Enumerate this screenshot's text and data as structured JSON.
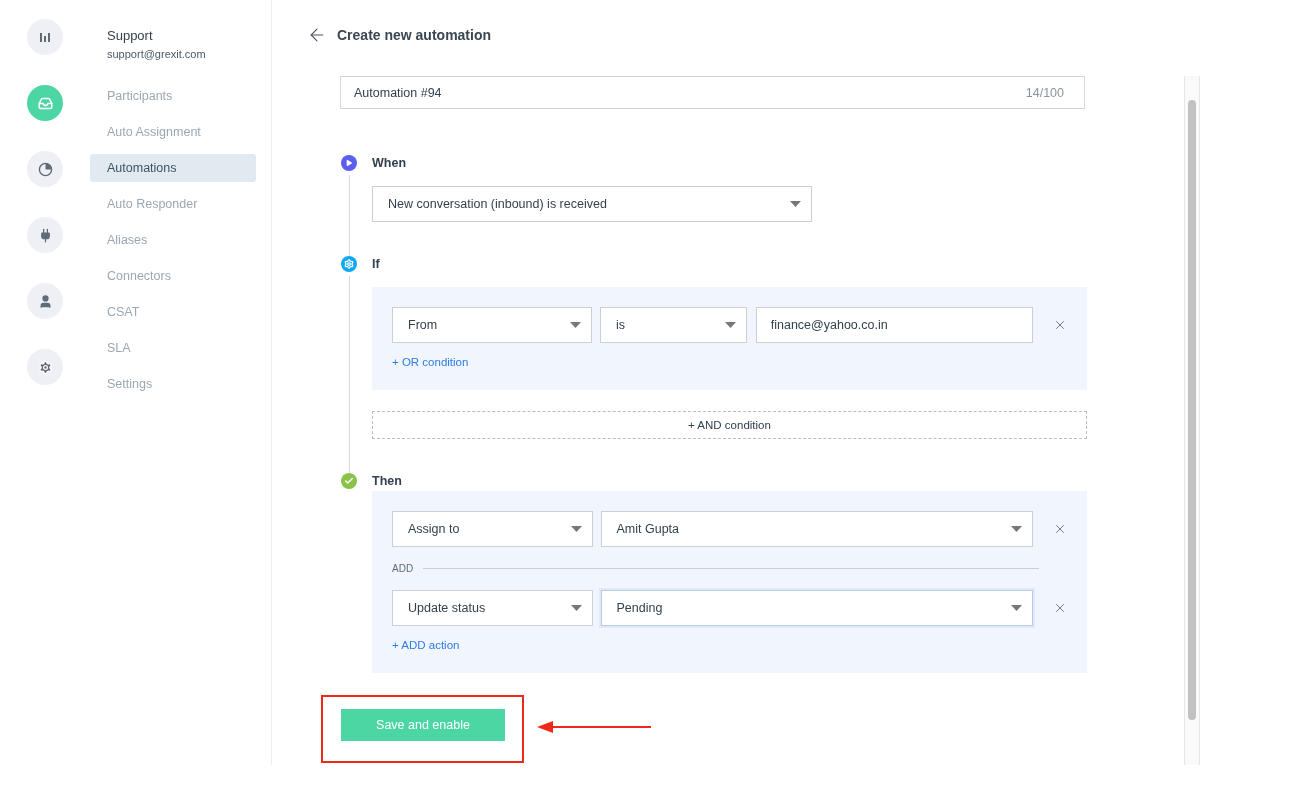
{
  "rail": [
    {
      "kind": "bars",
      "selected": false
    },
    {
      "kind": "inbox",
      "selected": true
    },
    {
      "kind": "pie",
      "selected": false
    },
    {
      "kind": "plug",
      "selected": false
    },
    {
      "kind": "user",
      "selected": false
    },
    {
      "kind": "gear",
      "selected": false
    }
  ],
  "account": {
    "name": "Support",
    "email": "support@grexit.com"
  },
  "nav": [
    {
      "label": "Participants",
      "selected": false
    },
    {
      "label": "Auto Assignment",
      "selected": false
    },
    {
      "label": "Automations",
      "selected": true
    },
    {
      "label": "Auto Responder",
      "selected": false
    },
    {
      "label": "Aliases",
      "selected": false
    },
    {
      "label": "Connectors",
      "selected": false
    },
    {
      "label": "CSAT",
      "selected": false
    },
    {
      "label": "SLA",
      "selected": false
    },
    {
      "label": "Settings",
      "selected": false
    }
  ],
  "header": {
    "title": "Create new automation"
  },
  "name_field": {
    "value": "Automation #94",
    "counter": "14/100"
  },
  "when": {
    "label": "When",
    "trigger": "New conversation (inbound) is received"
  },
  "if": {
    "label": "If",
    "conditions": [
      {
        "field": "From",
        "operator": "is",
        "value": "finance@yahoo.co.in"
      }
    ],
    "or_link": "+ OR condition",
    "and_button": "+ AND condition"
  },
  "then": {
    "label": "Then",
    "actions": [
      {
        "action": "Assign to",
        "value": "Amit Gupta",
        "focused": false
      },
      {
        "action": "Update status",
        "value": "Pending",
        "focused": true
      }
    ],
    "separator": "ADD",
    "add_link": "+ ADD action"
  },
  "save_button": "Save and enable"
}
